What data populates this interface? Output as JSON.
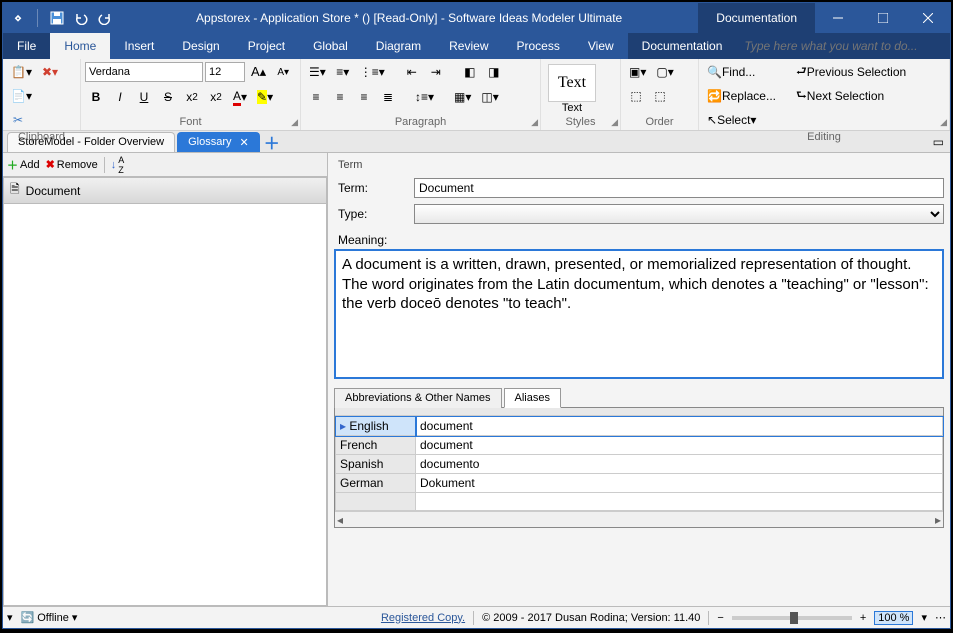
{
  "titlebar": {
    "title": "Appstorex - Application Store * () [Read-Only] - Software Ideas Modeler Ultimate",
    "doc_tab": "Documentation"
  },
  "tabs": {
    "file": "File",
    "items": [
      "Home",
      "Insert",
      "Design",
      "Project",
      "Global",
      "Diagram",
      "Review",
      "Process",
      "View"
    ],
    "doc2": "Documentation",
    "tell_placeholder": "Type here what you want to do..."
  },
  "ribbon": {
    "clipboard_label": "Clipboard",
    "font_label": "Font",
    "font_name": "Verdana",
    "font_size": "12",
    "paragraph_label": "Paragraph",
    "styles_label": "Styles",
    "text_preview": "Text",
    "text_btn": "Text",
    "order_label": "Order",
    "editing_label": "Editing",
    "find": "Find...",
    "replace": "Replace...",
    "select": "Select",
    "prev_sel": "Previous Selection",
    "next_sel": "Next Selection"
  },
  "doctabs": {
    "t1": "StoreModel - Folder Overview",
    "t2": "Glossary"
  },
  "side": {
    "add": "Add",
    "remove": "Remove",
    "item": "Document"
  },
  "term": {
    "section": "Term",
    "term_label": "Term:",
    "term_value": "Document",
    "type_label": "Type:",
    "type_value": "",
    "meaning_label": "Meaning:",
    "meaning_value": "A document is a written, drawn, presented, or memorialized representation of thought. The word originates from the Latin documentum, which denotes a \"teaching\" or \"lesson\": the verb doceō denotes \"to teach\"."
  },
  "subtabs": {
    "abbrev": "Abbreviations & Other Names",
    "aliases": "Aliases"
  },
  "aliases": [
    {
      "lang": "English",
      "val": "document"
    },
    {
      "lang": "French",
      "val": "document"
    },
    {
      "lang": "Spanish",
      "val": "documento"
    },
    {
      "lang": "German",
      "val": "Dokument"
    }
  ],
  "status": {
    "offline": "Offline",
    "registered": "Registered Copy.",
    "copyright": "© 2009 - 2017 Dusan Rodina; Version: 11.40",
    "zoom": "100 %"
  }
}
